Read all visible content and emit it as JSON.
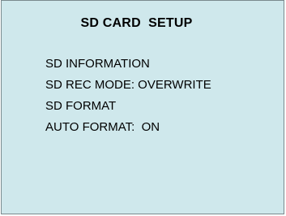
{
  "screen": {
    "title": "SD CARD  SETUP",
    "menu_items": [
      {
        "label": "SD INFORMATION"
      },
      {
        "label": "SD REC MODE: OVERWRITE"
      },
      {
        "label": "SD FORMAT"
      },
      {
        "label": "AUTO FORMAT:  ON"
      }
    ]
  },
  "colors": {
    "panel_background": "#cfe8ec",
    "text": "#000000"
  }
}
